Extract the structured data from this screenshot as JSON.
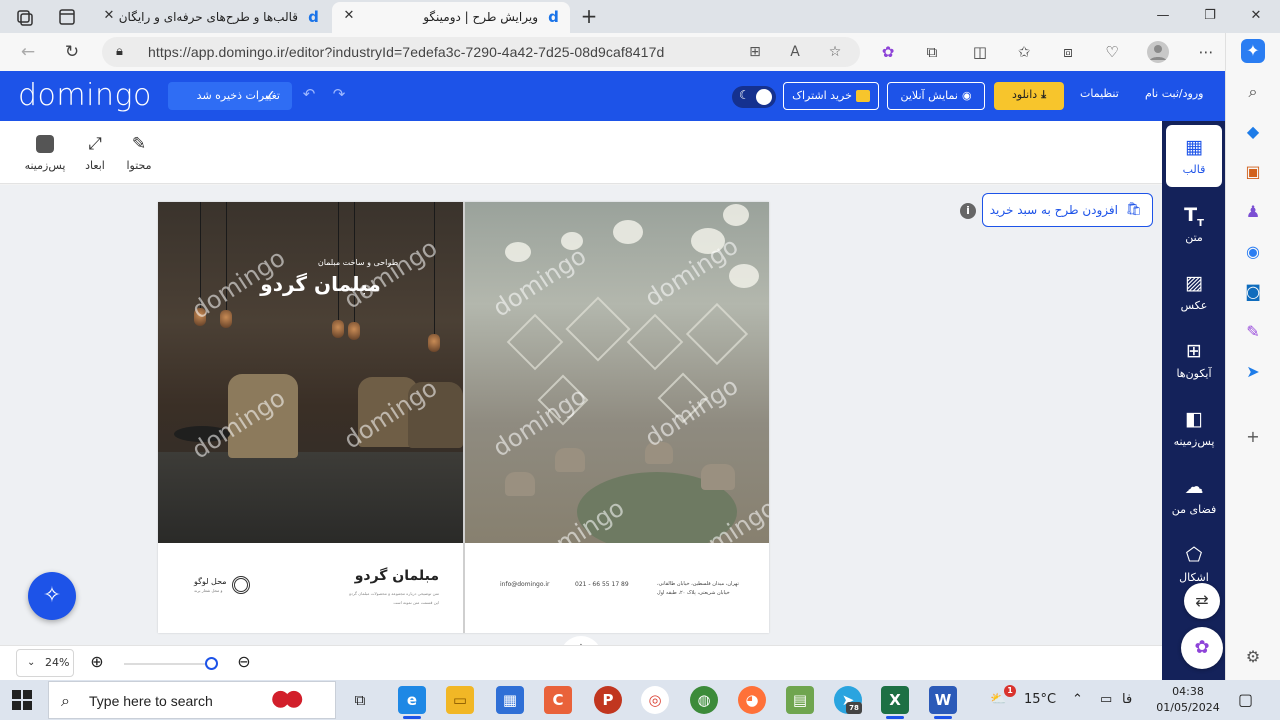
{
  "browser": {
    "tabs": [
      {
        "title": "قالب‌ها و طرح‌های حرفه‌ای و رایگان",
        "favicon": "d"
      },
      {
        "title": "ویرایش طرح | دومینگو",
        "favicon": "d"
      }
    ],
    "new_tab": "+",
    "url": "https://app.domingo.ir/editor?industryId=7edefa3c-7290-4a42-7d25-08d9caf8417d"
  },
  "app": {
    "logo": "domingo",
    "saved_label": "تغییرات ذخیره شد",
    "subscribe_label": "خرید اشتراک",
    "preview_label": "نمایش آنلاین",
    "download_label": "دانلود",
    "settings_label": "تنظیمات",
    "login_label": "ورود/ثبت نام",
    "accent": "#1d53e8"
  },
  "toolbar": {
    "content_label": "محتوا",
    "dimensions_label": "ابعاد",
    "background_label": "پس‌زمینه"
  },
  "canvas": {
    "add_to_cart_label": "افزودن طرح به سبد خرید",
    "info_icon": "i",
    "watermark": "domingo",
    "poster": {
      "subtitle": "طراحی و ساخت مبلمان",
      "title": "مبلمان گردو",
      "footer_title": "مبلمان گردو",
      "footer_line1": "متن توضیحی درباره مجموعه و محصولات مبلمان گردو",
      "footer_line2": "این قسمت متن نمونه است",
      "logo_text": "محل لوگو",
      "logo_sub": "و محل شعار برند",
      "email": "info@domingo.ir",
      "phone": "021 - 66 55 17 89",
      "address1": "تهران، میدان فلسطین، خیابان طالقانی،",
      "address2": "خیابان شریعتی، پلاک ۲۰، طبقه اول"
    }
  },
  "right_panel": {
    "items": [
      {
        "label": "قالب",
        "icon": "layout-icon"
      },
      {
        "label": "متن",
        "icon": "text-icon"
      },
      {
        "label": "عکس",
        "icon": "image-icon"
      },
      {
        "label": "آیکون‌ها",
        "icon": "grid-icon"
      },
      {
        "label": "پس‌زمینه",
        "icon": "background-icon"
      },
      {
        "label": "فضای من",
        "icon": "cloud-upload-icon"
      },
      {
        "label": "اشکال",
        "icon": "shapes-icon"
      }
    ]
  },
  "zoom": {
    "level": "24%",
    "slider_fraction": 0.96
  },
  "taskbar": {
    "search_placeholder": "Type here to search",
    "temperature": "15°C",
    "language": "فا",
    "time": "04:38",
    "date": "01/05/2024",
    "notification_count": "1",
    "telegram_badge": "78"
  }
}
